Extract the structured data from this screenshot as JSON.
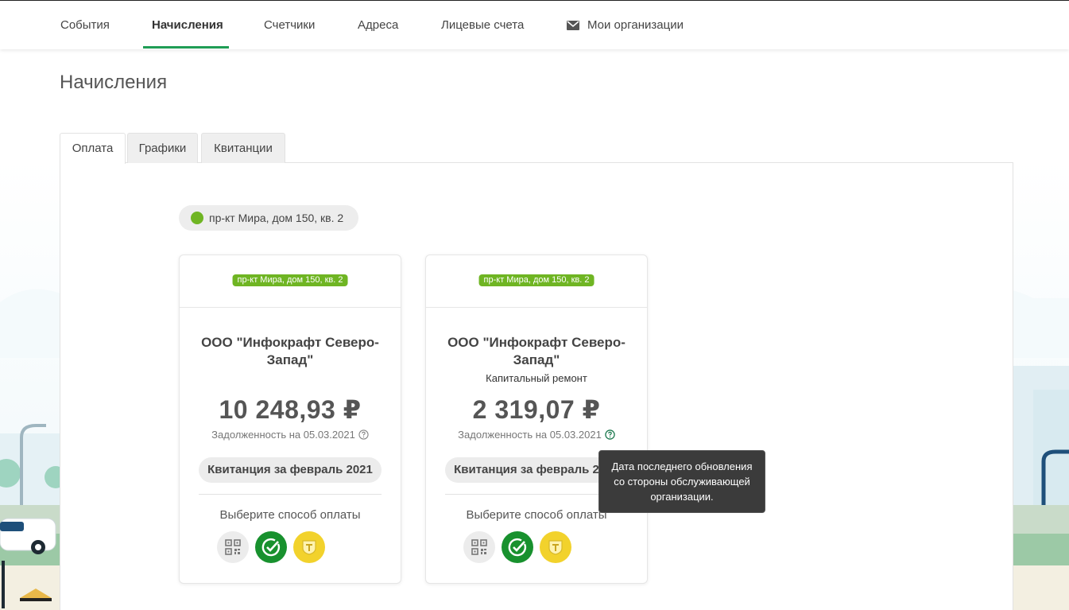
{
  "nav": {
    "items": [
      {
        "label": "События"
      },
      {
        "label": "Начисления"
      },
      {
        "label": "Счетчики"
      },
      {
        "label": "Адреса"
      },
      {
        "label": "Лицевые счета"
      },
      {
        "label": "Мои организации",
        "icon": "mail-icon"
      }
    ],
    "active_index": 1
  },
  "page_title": "Начисления",
  "tabs": [
    {
      "label": "Оплата"
    },
    {
      "label": "Графики"
    },
    {
      "label": "Квитанции"
    }
  ],
  "address_filter": {
    "label": "пр-кт Мира, дом 150, кв. 2",
    "status_color": "#6fb523"
  },
  "cards": [
    {
      "badge": "пр-кт Мира, дом 150, кв. 2",
      "org": "ООО \"Инфокрафт Северо-Запад\"",
      "service": "",
      "amount": "10 248,93 ₽",
      "debt_label": "Задолженность на 05.03.2021",
      "receipt_button": "Квитанция за февраль 2021",
      "pay_label": "Выберите способ оплаты",
      "pay_methods": [
        "qr-code-icon",
        "check-circle-icon",
        "tinkoff-icon"
      ]
    },
    {
      "badge": "пр-кт Мира, дом 150, кв. 2",
      "org": "ООО \"Инфокрафт Северо-Запад\"",
      "service": "Капитальный ремонт",
      "amount": "2 319,07 ₽",
      "debt_label": "Задолженность на 05.03.2021",
      "receipt_button": "Квитанция за февраль 2021",
      "pay_label": "Выберите способ оплаты",
      "pay_methods": [
        "qr-code-icon",
        "check-circle-icon",
        "tinkoff-icon"
      ]
    }
  ],
  "tooltip": {
    "line1": "Дата последнего обновления",
    "line2": "со стороны обслуживающей",
    "line3": "организации."
  },
  "colors": {
    "accent_green": "#1f9d55",
    "badge_green": "#6fb523",
    "pay_green": "#18912e",
    "pay_yellow": "#f2d22c",
    "tooltip_bg": "#3b3b3b"
  }
}
